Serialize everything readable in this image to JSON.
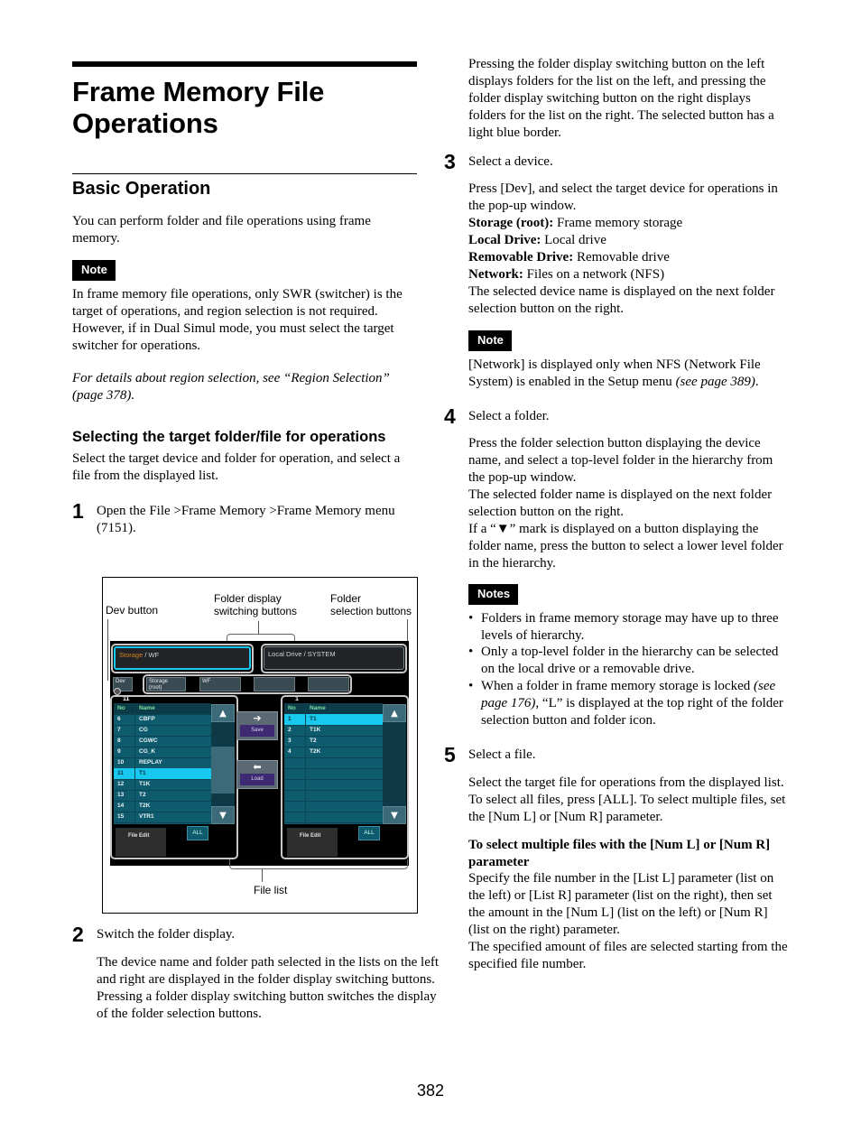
{
  "header": {
    "title_line1": "Frame Memory File",
    "title_line2": "Operations"
  },
  "basic_operation": {
    "heading": "Basic Operation",
    "intro": "You can perform folder and file operations using frame memory.",
    "note_label": "Note",
    "note_text": "In frame memory file operations, only SWR (switcher) is the target of operations, and region selection is not required. However, if in Dual Simul mode, you must select the target switcher for operations.",
    "reference_text": "For details about region selection, see “Region Selection” (page 378)."
  },
  "selecting": {
    "heading": "Selecting the target folder/file for operations",
    "intro": "Select the target device and folder for operation, and select a file from the displayed list.",
    "step1": {
      "num": "1",
      "text": "Open the File >Frame Memory >Frame Memory menu (7151)."
    },
    "step2": {
      "num": "2",
      "title": "Switch the folder display.",
      "body1": "The device name and folder path selected in the lists on the left and right are displayed in the folder display switching buttons.",
      "body2": "Pressing a folder display switching button switches the display of the folder selection buttons.",
      "body3": "Pressing the folder display switching button on the left displays folders for the list on the left, and pressing the folder display switching button on the right displays folders for the list on the right. The selected button has a light blue border."
    },
    "step3": {
      "num": "3",
      "title": "Select a device.",
      "body": "Press [Dev], and select the target device for operations in the pop-up window.",
      "devices": [
        {
          "name": "Storage (root):",
          "desc": "Frame memory storage"
        },
        {
          "name": "Local Drive:",
          "desc": "Local drive"
        },
        {
          "name": "Removable Drive:",
          "desc": "Removable drive"
        },
        {
          "name": "Network:",
          "desc": "Files on a network (NFS)"
        }
      ],
      "after": "The selected device name is displayed on the next folder selection button on the right.",
      "note_label": "Note",
      "note_text": "[Network] is displayed only when NFS (Network File System) is enabled in the Setup menu",
      "note_ref": "(see page 389)",
      "note_end": "."
    },
    "step4": {
      "num": "4",
      "title": "Select a folder.",
      "body1": "Press the folder selection button displaying the device name, and select a top-level folder in the hierarchy from the pop-up window.",
      "body2": "The selected folder name is displayed on the next folder selection button on the right.",
      "body3": "If a “▼” mark is displayed on a button displaying the folder name, press the button to select a lower level folder in the hierarchy.",
      "notes_label": "Notes",
      "notes": [
        "Folders in frame memory storage may have up to three levels of hierarchy.",
        "Only a top-level folder in the hierarchy can be selected on the local drive or a removable drive."
      ],
      "note3_pre": "When a folder in frame memory storage is locked ",
      "note3_ref": "(see page 176)",
      "note3_post": ", “L” is displayed at the top right of the folder selection button and folder icon."
    },
    "step5": {
      "num": "5",
      "title": "Select a file.",
      "body1": "Select the target file for operations from the displayed list.",
      "body2": "To select all files, press [ALL]. To select multiple files, set the [Num L] or [Num R] parameter.",
      "subheading": "To select multiple files with the [Num L] or [Num R] parameter",
      "body3": "Specify the file number in the [List L] parameter (list on the left) or [List R] parameter (list on the right), then set the amount in the [Num L] (list on the left) or [Num R] (list on the right) parameter.",
      "body4": "The specified amount of files are selected starting from the specified file number."
    }
  },
  "figure": {
    "callouts": {
      "dev_button": "Dev button",
      "folder_display": "Folder display\nswitching buttons",
      "folder_display_l1": "Folder display",
      "folder_display_l2": "switching buttons",
      "folder_selection_l1": "Folder",
      "folder_selection_l2": "selection buttons",
      "file_list": "File list"
    },
    "left_display": {
      "device": "Storage",
      "path": " / WF",
      "selected": true
    },
    "right_display": {
      "device": "Local Drive",
      "path": " / SYSTEM",
      "selected": false
    },
    "dev_label": "Dev",
    "folder_buttons": [
      "Storage\n(root)",
      "WF",
      "",
      ""
    ],
    "folder_button_1_l1": "Storage",
    "folder_button_1_l2": "(root)",
    "folder_button_2": "WF",
    "left_list": {
      "count": "11",
      "headers": [
        "No",
        "Name"
      ],
      "rows": [
        {
          "no": "6",
          "name": "CBFP"
        },
        {
          "no": "7",
          "name": "CG"
        },
        {
          "no": "8",
          "name": "CGWC"
        },
        {
          "no": "9",
          "name": "CG_K"
        },
        {
          "no": "10",
          "name": "REPLAY"
        },
        {
          "no": "11",
          "name": "T1",
          "selected": true
        },
        {
          "no": "12",
          "name": "T1K"
        },
        {
          "no": "13",
          "name": "T2"
        },
        {
          "no": "14",
          "name": "T2K"
        },
        {
          "no": "15",
          "name": "VTR1"
        }
      ],
      "file_edit": "File Edit",
      "all": "ALL"
    },
    "right_list": {
      "count": "1",
      "headers": [
        "No",
        "Name"
      ],
      "rows": [
        {
          "no": "1",
          "name": "T1",
          "selected": true
        },
        {
          "no": "2",
          "name": "T1K"
        },
        {
          "no": "3",
          "name": "T2"
        },
        {
          "no": "4",
          "name": "T2K"
        }
      ],
      "file_edit": "File Edit",
      "all": "ALL"
    },
    "save_label": "Save",
    "load_label": "Load",
    "icons": {
      "save_arrow": "➔",
      "load_arrow": "⬅",
      "up": "▲",
      "down": "▼"
    }
  },
  "footer": {
    "page_number": "382"
  }
}
